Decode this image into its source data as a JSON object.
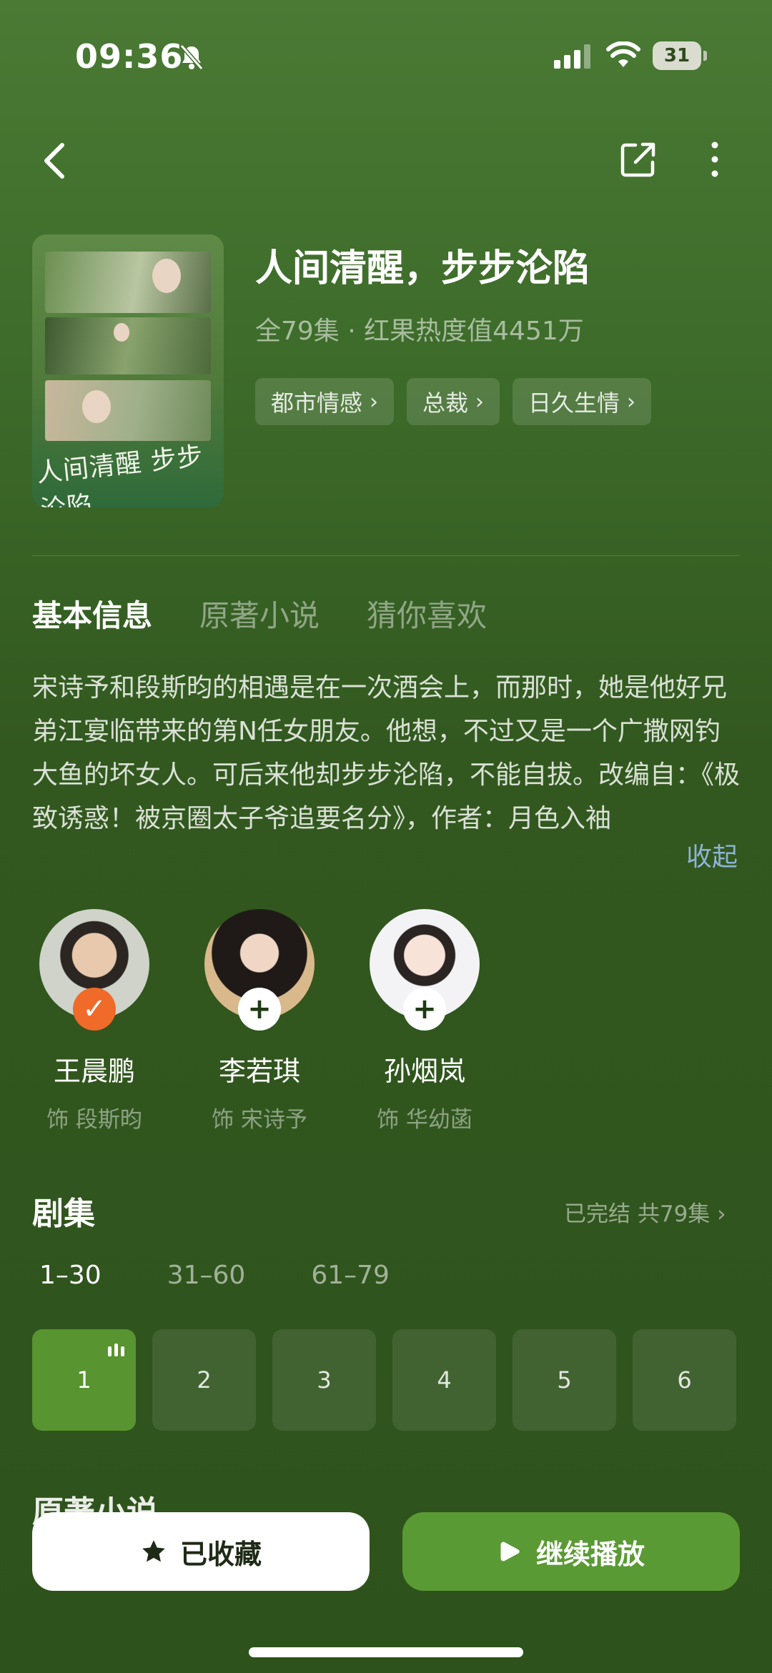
{
  "status_bar": {
    "time": "09:36",
    "battery": "31"
  },
  "drama": {
    "title": "人间清醒，步步沦陷",
    "meta": "全79集 · 红果热度值4451万",
    "poster_title": "人间清醒 步步沦陷",
    "tags": [
      "都市情感",
      "总裁",
      "日久生情"
    ]
  },
  "tabs": [
    "基本信息",
    "原著小说",
    "猜你喜欢"
  ],
  "synopsis": "宋诗予和段斯昀的相遇是在一次酒会上，而那时，她是他好兄弟江宴临带来的第N任女朋友。他想，不过又是一个广撒网钓大鱼的坏女人。可后来他却步步沦陷，不能自拔。改编自：《极致诱惑！被京圈太子爷追要名分》，作者：月色入袖",
  "collapse_label": "收起",
  "cast": [
    {
      "name": "王晨鹏",
      "role": "饰 段斯昀",
      "followed": true
    },
    {
      "name": "李若琪",
      "role": "饰 宋诗予",
      "followed": false
    },
    {
      "name": "孙烟岚",
      "role": "饰 华幼菡",
      "followed": false
    }
  ],
  "episodes": {
    "title": "剧集",
    "status": "已完结 共79集",
    "ranges": [
      "1–30",
      "31–60",
      "61–79"
    ],
    "items": [
      "1",
      "2",
      "3",
      "4",
      "5",
      "6"
    ]
  },
  "novel_heading": "原著小说",
  "buttons": {
    "favorite": "已收藏",
    "continue": "继续播放"
  },
  "colors": {
    "accent": "#5a9a34",
    "followed_badge": "#f06a2a",
    "link": "#8eb3d8"
  }
}
